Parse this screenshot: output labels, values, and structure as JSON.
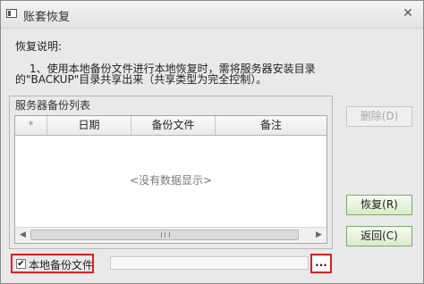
{
  "window": {
    "title": "账套恢复",
    "close_label": "✕"
  },
  "description": {
    "heading": "恢复说明:",
    "line1": "1、使用本地备份文件进行本地恢复时，需将服务器安装目录",
    "line2": "的\"BACKUP\"目录共享出来（共享类型为完全控制）。"
  },
  "backup_list": {
    "legend": "服务器备份列表",
    "columns": [
      "*",
      "日期",
      "备份文件",
      "备注"
    ],
    "rows": [],
    "empty_text": "<没有数据显示>"
  },
  "buttons": {
    "delete": "删除(D)",
    "restore": "恢复(R)",
    "back": "返回(C)"
  },
  "local_backup": {
    "checkbox_label": "本地备份文件",
    "checked": true,
    "file_value": "",
    "browse_label": "..."
  }
}
